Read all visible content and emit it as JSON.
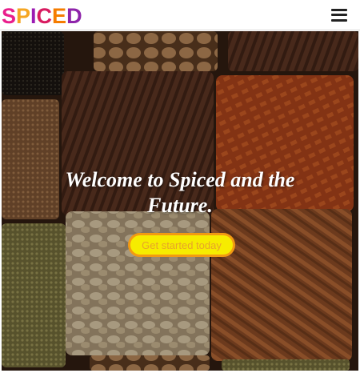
{
  "brand": {
    "name": "SPICED",
    "letter_colors": [
      "#e91e8c",
      "#f5a623",
      "#9b1bb3",
      "#d81b60",
      "#f57c00",
      "#8e24aa"
    ]
  },
  "nav": {
    "menu_icon": "hamburger-menu-icon"
  },
  "hero": {
    "title": "Welcome to Spiced and the Future.",
    "cta_label": "Get started today",
    "cta_colors": {
      "background": "#f6ec00",
      "border": "#f29a12",
      "text": "#e8a428"
    }
  }
}
